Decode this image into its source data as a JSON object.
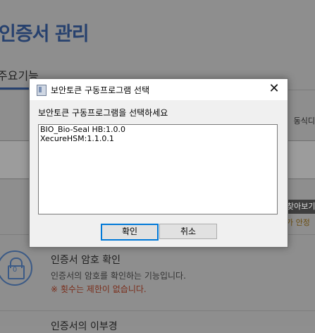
{
  "background": {
    "page_title": "인증서 관리",
    "tab_label": "주요기능",
    "right_note": "동식디",
    "side_button": "찾아보기",
    "side_note": "가 안정",
    "feature": {
      "title": "인증서 암호 확인",
      "description": "인증서의 암호를 확인하는 기능입니다.",
      "note": "※ 횟수는 제한이 없습니다.",
      "icon": "lock-icon",
      "icon_text": "0"
    },
    "next_feature_title": "인증서의 이부경"
  },
  "dialog": {
    "title": "보안토큰 구동프로그램 선택",
    "close_label": "✕",
    "prompt": "보안토큰 구동프로그램을 선택하세요",
    "items": [
      "BIO_Bio-Seal HB:1.0.0",
      "XecureHSM:1.1.0.1"
    ],
    "ok_label": "확인",
    "cancel_label": "취소"
  },
  "colors": {
    "accent": "#27416e",
    "focus": "#0078d7",
    "note": "#7a2d1a"
  }
}
